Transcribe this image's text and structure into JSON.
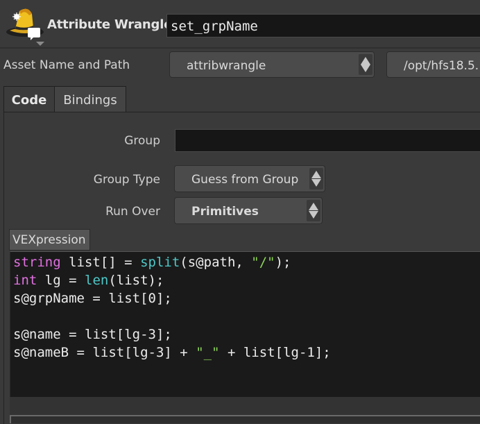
{
  "header": {
    "node_type": "Attribute Wrangle",
    "node_name": "set_grpName"
  },
  "asset": {
    "label": "Asset Name and Path",
    "name_value": "attribwrangle",
    "path_value": "/opt/hfs18.5."
  },
  "tabs": [
    {
      "label": "Code",
      "active": true
    },
    {
      "label": "Bindings",
      "active": false
    }
  ],
  "params": {
    "group_label": "Group",
    "group_value": "",
    "group_type_label": "Group Type",
    "group_type_value": "Guess from Group",
    "run_over_label": "Run Over",
    "run_over_value": "Primitives"
  },
  "vex": {
    "label": "VEXpression",
    "lines": [
      "string list[] = split(s@path, \"/\");",
      "int lg = len(list);",
      "s@grpName = list[0];",
      "",
      "s@name = list[lg-3];",
      "s@nameB = list[lg-3] + \"_\" + list[lg-1];"
    ],
    "colors": {
      "keyword": "#e070e0",
      "function": "#4fc8c8",
      "string": "#8ed45a",
      "text": "#ececec"
    }
  },
  "icons": {
    "node": "wizard-hat-icon",
    "menu_arrows": "up-down-arrows-icon"
  }
}
